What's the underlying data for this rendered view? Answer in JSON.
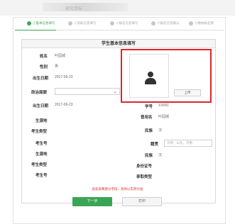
{
  "header": {
    "blurred_text": "研究目标"
  },
  "steps": [
    {
      "label": "①基本信息填写",
      "active": true
    },
    {
      "label": "②资助信息填写",
      "active": false
    },
    {
      "label": "③报名信息填写",
      "active": false
    },
    {
      "label": "④报名信息确认",
      "active": false
    },
    {
      "label": "⑤缴纳报名费",
      "active": false
    }
  ],
  "form": {
    "title": "学生基本信息填写",
    "name_label": "姓名",
    "name_value": "叶园城",
    "gender_label": "性别",
    "gender_value": "男",
    "birth_label": "出生日期",
    "birth_value": "2017-06-23",
    "political_label": "政治面貌",
    "political_value": "",
    "birth2_label": "出生日期",
    "birth2_value": "2017-06-23",
    "source_label": "生源地",
    "exam_type_label": "考生类型",
    "exam_no_label": "考生号",
    "source2_label": "生源地",
    "exam_type2_label": "考生类型",
    "exam_no2_label": "考生号",
    "student_no_label": "学号",
    "student_no_value": "XX001",
    "used_name_label": "曾用名",
    "used_name_value": "叶园城",
    "nation_label": "民族",
    "nation_value": "汉",
    "native_label": "籍贯",
    "native_placeholder": "示例：山东，济南",
    "nation2_label": "民族",
    "nation2_value": "汉",
    "id_label": "身份证号",
    "admit_label": "录取类型",
    "upload_label": "上传"
  },
  "footer": {
    "note": "此处省略部分字段，具体以实际为准",
    "next_label": "下一步",
    "print_label": "打印"
  },
  "colors": {
    "accent": "#3aa655",
    "highlight": "#e0242a"
  }
}
